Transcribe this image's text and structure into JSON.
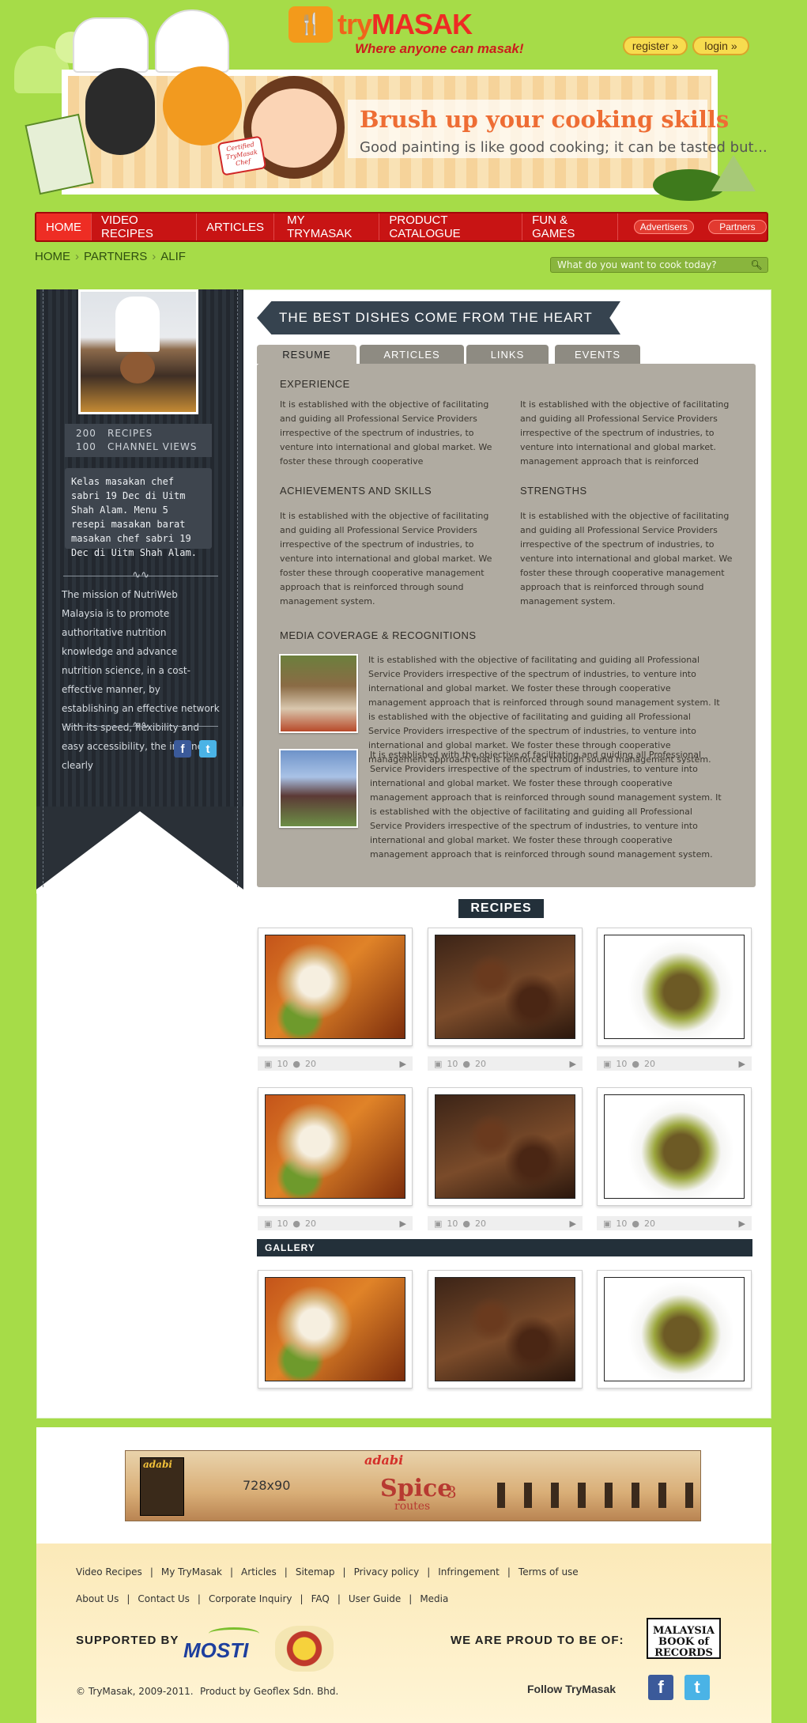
{
  "header": {
    "logo_name_a": "try",
    "logo_name_b": "MASAK",
    "logo_tagline": "Where anyone can masak!",
    "register_label": "register »",
    "login_label": "login »",
    "banner_title": "Brush up your cooking skills",
    "banner_subtitle": "Good painting is like good cooking; it can be tasted but...",
    "certified_badge": "Certified TryMasak Chef"
  },
  "nav": {
    "items": [
      "HOME",
      "VIDEO RECIPES",
      "ARTICLES",
      "MY TRYMASAK",
      "PRODUCT CATALOGUE",
      "FUN & GAMES"
    ],
    "advertisers": "Advertisers",
    "partners": "Partners"
  },
  "breadcrumb": [
    "HOME",
    "PARTNERS",
    "ALIF"
  ],
  "search": {
    "placeholder": "What do you want to cook today?"
  },
  "profile": {
    "recipes_count": "200",
    "recipes_label": "RECIPES",
    "views_count": "100",
    "views_label": "CHANNEL VIEWS",
    "about": "Kelas masakan chef sabri 19 Dec di Uitm Shah Alam. Menu 5 resepi masakan barat masakan chef sabri 19 Dec di Uitm Shah Alam.",
    "mission": "The mission of NutriWeb Malaysia is to promote authoritative nutrition knowledge and advance nutrition science, in a cost-effective manner, by establishing an effective network With its speed, flexibility and easy accessibility, the internet clearly"
  },
  "main": {
    "heading": "THE BEST DISHES COME FROM THE HEART",
    "tabs": [
      "RESUME",
      "ARTICLES",
      "LINKS",
      "EVENTS"
    ],
    "experience_title": "EXPERIENCE",
    "experience_col1": "It is established with the objective of facilitating and guiding all Professional Service Providers irrespective of the spectrum of industries, to venture into international and global market. We foster these through cooperative",
    "experience_col2": "It is established with the objective of facilitating and guiding all Professional Service Providers irrespective of the spectrum of industries, to venture into international and global market. management approach that is reinforced",
    "achievements_title": "ACHIEVEMENTS AND SKILLS",
    "achievements_text": "It is established with the objective of facilitating and guiding all Professional Service Providers irrespective of the spectrum of industries, to venture into international and global market. We foster these through cooperative management approach that is reinforced through sound management system.",
    "strengths_title": "STRENGTHS",
    "strengths_text": "It is established with the objective of facilitating and guiding all Professional Service Providers irrespective of the spectrum of industries, to venture into international and global market. We foster these through cooperative management approach that is reinforced through sound management system.",
    "media_title": "MEDIA COVERAGE & RECOGNITIONS",
    "media_items": [
      "It is established with the objective of facilitating and guiding all Professional Service Providers irrespective of the spectrum of industries, to venture into international and global market. We foster these through cooperative management approach that is reinforced through sound management system. It is established with the objective of facilitating and guiding all Professional Service Providers irrespective of the spectrum of industries, to venture into international and global market. We foster these through cooperative management approach that is reinforced through sound management system.",
      "It is established with the objective of facilitating and guiding all Professional Service Providers irrespective of the spectrum of industries, to venture into international and global market. We foster these through cooperative management approach that is reinforced through sound management system. It is established with the objective of facilitating and guiding all Professional Service Providers irrespective of the spectrum of industries, to venture into international and global market. We foster these through cooperative management approach that is reinforced through sound management system."
    ]
  },
  "recipes": {
    "heading": "RECIPES",
    "photo_count": "10",
    "comment_count": "20",
    "gallery_heading": "GALLERY"
  },
  "ad": {
    "size_label": "728x90",
    "brand": "adabi",
    "campaign_a": "Spice",
    "campaign_b": "routes",
    "campaign_num": "3"
  },
  "footer": {
    "links_row1": [
      "Video Recipes",
      "My TryMasak",
      "Articles",
      "Sitemap",
      "Privacy policy",
      "Infringement",
      "Terms of use"
    ],
    "links_row2": [
      "About Us",
      "Contact Us",
      "Corporate Inquiry",
      "FAQ",
      "User Guide",
      "Media"
    ],
    "supported_by": "SUPPORTED BY",
    "mosti": "MOSTI",
    "proud": "WE ARE PROUD TO BE OF:",
    "mbr": "MALAYSIA BOOK of RECORDS",
    "copyright": "© TryMasak, 2009-2011.",
    "product_by": "Product by Geoflex Sdn. Bhd.",
    "follow": "Follow TryMasak"
  },
  "colors": {
    "page_bg": "#a6dc48",
    "nav_red": "#c81414",
    "sidebar_dark": "#2c333b",
    "panel_taupe": "#b0aba1",
    "accent_orange": "#f0641b"
  }
}
